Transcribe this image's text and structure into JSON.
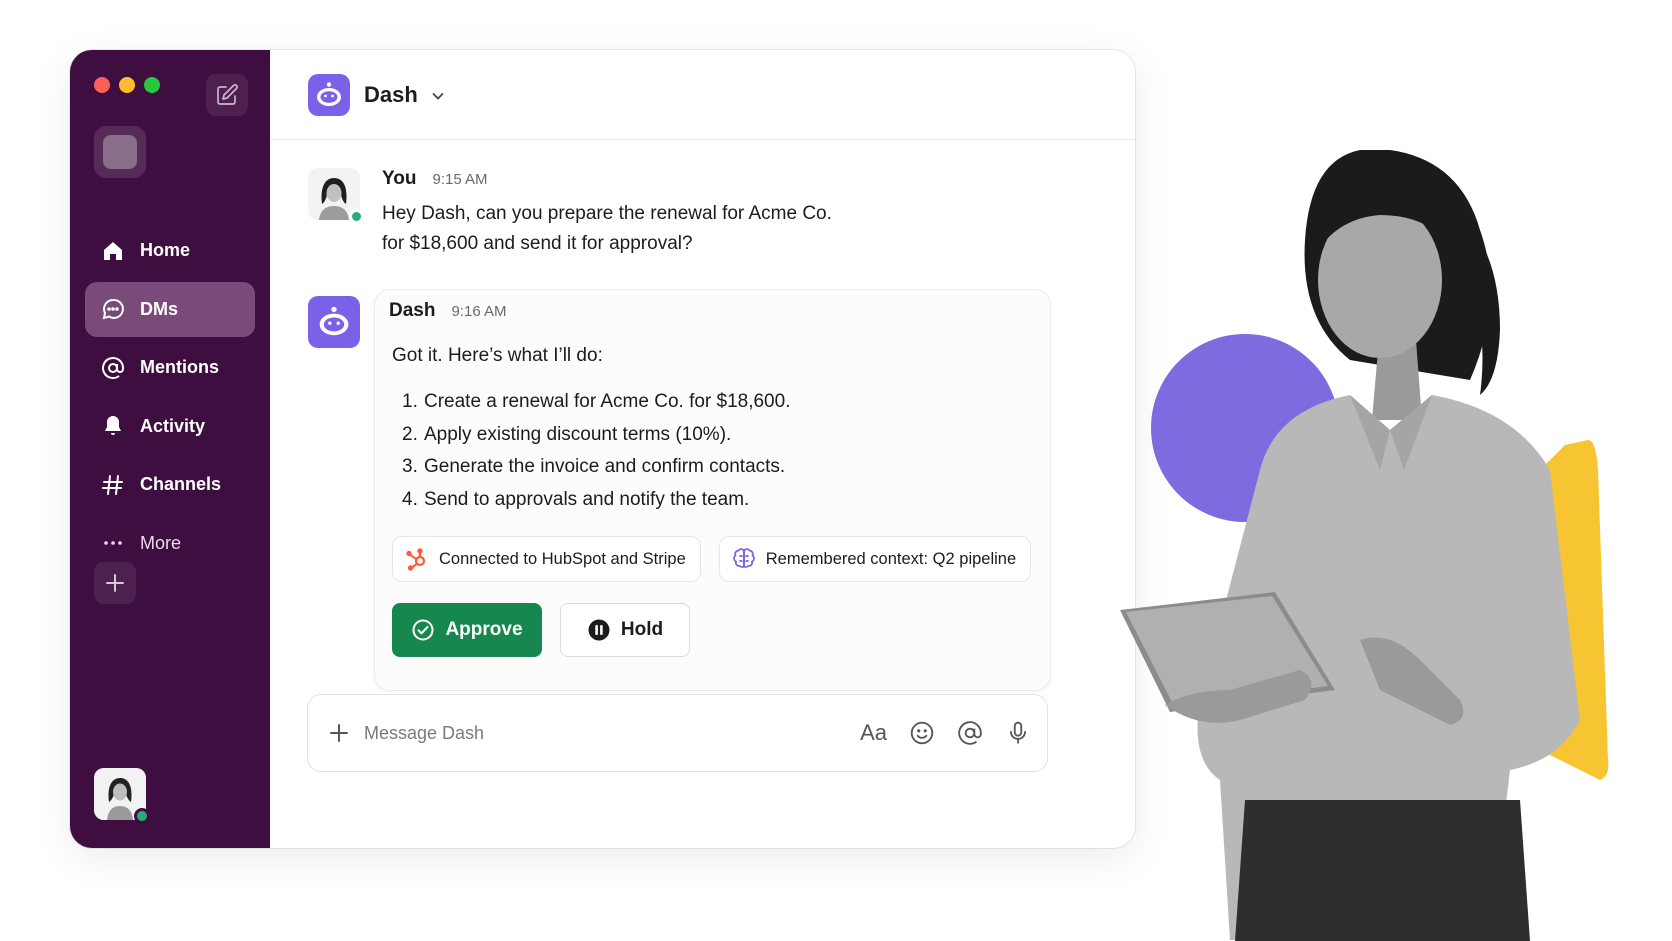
{
  "sidebar": {
    "items": [
      {
        "label": "Home",
        "icon": "home-icon"
      },
      {
        "label": "DMs",
        "icon": "dm-icon",
        "active": true
      },
      {
        "label": "Mentions",
        "icon": "at-icon"
      },
      {
        "label": "Activity",
        "icon": "bell-icon"
      },
      {
        "label": "Channels",
        "icon": "hash-icon"
      },
      {
        "label": "More",
        "icon": "ellipsis-icon"
      }
    ]
  },
  "header": {
    "title": "Dash"
  },
  "messages": {
    "user": {
      "author": "You",
      "time": "9:15 AM",
      "line1": "Hey Dash, can you prepare the renewal for Acme Co.",
      "line2": "for $18,600 and send it for approval?"
    },
    "dash": {
      "author": "Dash",
      "time": "9:16 AM",
      "lead": "Got it. Here’s what I’ll do:",
      "steps": [
        {
          "num": "1.",
          "text": "Create a renewal for Acme Co. for $18,600."
        },
        {
          "num": "2.",
          "text": "Apply existing discount terms (10%)."
        },
        {
          "num": "3.",
          "text": "Generate the invoice and confirm contacts."
        },
        {
          "num": "4.",
          "text": "Send to approvals and notify the team."
        }
      ],
      "chips": [
        {
          "label": "Connected to HubSpot and Stripe",
          "icon": "hubspot-icon"
        },
        {
          "label": "Remembered context: Q2 pipeline",
          "icon": "brain-icon"
        }
      ],
      "approve_label": "Approve",
      "hold_label": "Hold"
    }
  },
  "composer": {
    "placeholder": "Message Dash",
    "format_label": "Aa"
  },
  "colors": {
    "sidebar": "#3f0e40",
    "sidebar_active": "#7a4a7b",
    "bot_accent": "#7b61e8",
    "approve": "#16874e",
    "deco_purple": "#7f6ae0",
    "deco_yellow": "#f7c531"
  }
}
